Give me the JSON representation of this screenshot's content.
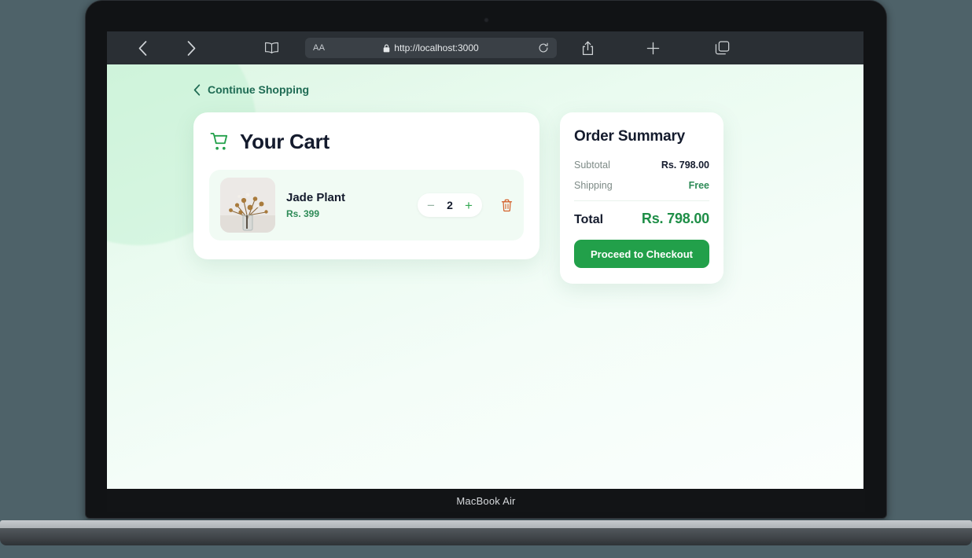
{
  "device": {
    "model_label": "MacBook Air",
    "outer_background": "#4e6269"
  },
  "browser": {
    "toolbar": {
      "back_icon": "chevron-left-icon",
      "forward_icon": "chevron-right-icon",
      "reader_icon": "book-icon",
      "aa_label": "AA",
      "lock_icon": "lock-icon",
      "url": "http://localhost:3000",
      "reload_icon": "reload-icon",
      "share_icon": "share-icon",
      "new_tab_icon": "plus-icon",
      "tabs_icon": "tabs-icon"
    }
  },
  "page": {
    "back_link": {
      "icon": "chevron-left-icon",
      "label": "Continue Shopping"
    },
    "cart": {
      "icon": "shopping-cart-icon",
      "title": "Your Cart",
      "items": [
        {
          "name": "Jade Plant",
          "price": "Rs. 399",
          "quantity": "2",
          "decrease_label": "−",
          "increase_label": "+",
          "remove_icon": "trash-icon",
          "thumbnail_alt": "dried flowers in glass vase"
        }
      ]
    },
    "summary": {
      "title": "Order Summary",
      "rows": [
        {
          "label": "Subtotal",
          "value": "Rs. 798.00",
          "style": "dark"
        },
        {
          "label": "Shipping",
          "value": "Free",
          "style": "green"
        }
      ],
      "total_label": "Total",
      "total_value": "Rs. 798.00",
      "checkout_label": "Proceed to Checkout"
    }
  },
  "colors": {
    "brand_green": "#22a04a",
    "total_green": "#1e8e47",
    "price_green": "#2e8b57",
    "link_green": "#1f6b54",
    "text_dark": "#141b2d",
    "muted": "#7d8a86",
    "trash_orange": "#d4602a",
    "card_bg": "#ffffff",
    "item_bg": "#f1fbf4"
  }
}
